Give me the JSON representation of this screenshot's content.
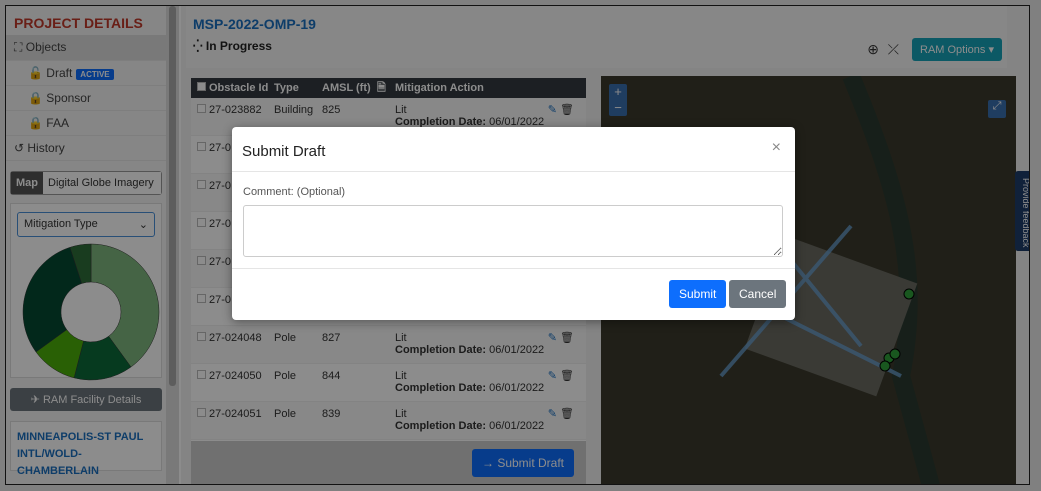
{
  "sidebar": {
    "title": "PROJECT DETAILS",
    "objects": "Objects",
    "draft": "Draft",
    "active_badge": "ACTIVE",
    "sponsor": "Sponsor",
    "faa": "FAA",
    "history": "History",
    "map_label": "Map",
    "map_value": "Digital Globe Imagery",
    "chart_select": "Mitigation Type",
    "ram_button": "RAM Facility Details",
    "facility": "MINNEAPOLIS-ST PAUL INTL/WOLD-CHAMBERLAIN"
  },
  "donut": [
    {
      "pct": 40,
      "color": "#7fb77e"
    },
    {
      "pct": 14,
      "color": "#0b6b3a"
    },
    {
      "pct": 11,
      "color": "#4caf0a"
    },
    {
      "pct": 30,
      "color": "#044a32"
    },
    {
      "pct": 5,
      "color": "#2f6e3a"
    }
  ],
  "header": {
    "title": "MSP-2022-OMP-19",
    "status": "In Progress",
    "ram_options": "RAM Options"
  },
  "table": {
    "headers": [
      "Obstacle Id",
      "Type",
      "AMSL (ft)",
      "Mitigation Action"
    ],
    "completion_label": "Completion Date:",
    "rows": [
      {
        "id": "27-023882",
        "type": "Building",
        "amsl": "825",
        "action": "Lit",
        "date": "06/01/2022"
      },
      {
        "id": "27-0",
        "type": "",
        "amsl": "",
        "action": "",
        "date": ""
      },
      {
        "id": "27-0",
        "type": "",
        "amsl": "",
        "action": "",
        "date": ""
      },
      {
        "id": "27-0",
        "type": "",
        "amsl": "",
        "action": "",
        "date": ""
      },
      {
        "id": "27-0",
        "type": "",
        "amsl": "",
        "action": "",
        "date": ""
      },
      {
        "id": "27-0",
        "type": "",
        "amsl": "",
        "action": "",
        "date": ""
      },
      {
        "id": "27-024048",
        "type": "Pole",
        "amsl": "827",
        "action": "Lit",
        "date": "06/01/2022"
      },
      {
        "id": "27-024050",
        "type": "Pole",
        "amsl": "844",
        "action": "Lit",
        "date": "06/01/2022"
      },
      {
        "id": "27-024051",
        "type": "Pole",
        "amsl": "839",
        "action": "Lit",
        "date": "06/01/2022"
      }
    ],
    "submit_draft": "Submit Draft"
  },
  "map": {
    "feedback": "Provide feedback"
  },
  "modal": {
    "title": "Submit Draft",
    "comment_label": "Comment: (Optional)",
    "comment_value": "",
    "submit": "Submit",
    "cancel": "Cancel"
  }
}
